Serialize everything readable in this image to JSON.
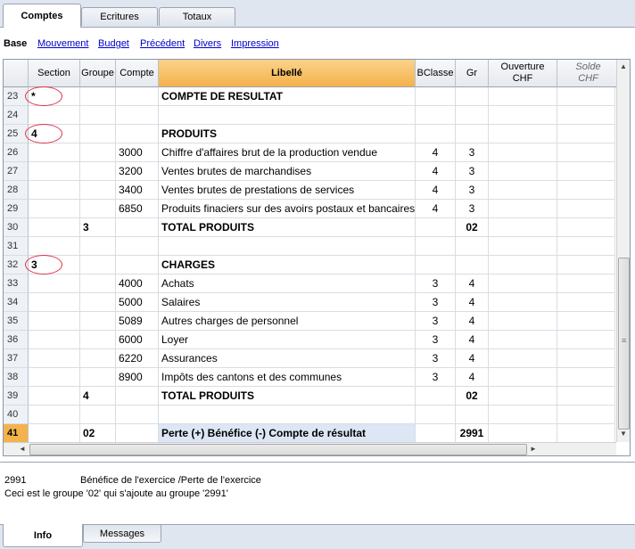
{
  "tabs": [
    {
      "label": "Comptes",
      "active": true
    },
    {
      "label": "Ecritures",
      "active": false
    },
    {
      "label": "Totaux",
      "active": false
    }
  ],
  "views": {
    "base": "Base",
    "links": [
      "Mouvement",
      "Budget",
      "Précédent",
      "Divers",
      "Impression"
    ]
  },
  "table": {
    "headers": {
      "section": "Section",
      "groupe": "Groupe",
      "compte": "Compte",
      "libelle": "Libellé",
      "bclasse": "BClasse",
      "gr": "Gr",
      "ouverture": "Ouverture CHF",
      "solde": "Solde CHF"
    },
    "rows": [
      {
        "n": "23",
        "section": "*",
        "groupe": "",
        "compte": "",
        "libelle": "COMPTE DE RESULTAT",
        "bclasse": "",
        "gr": "",
        "bold": true,
        "circled": true
      },
      {
        "n": "24",
        "section": "",
        "groupe": "",
        "compte": "",
        "libelle": "",
        "bclasse": "",
        "gr": ""
      },
      {
        "n": "25",
        "section": "4",
        "groupe": "",
        "compte": "",
        "libelle": "PRODUITS",
        "bclasse": "",
        "gr": "",
        "bold": true,
        "circled": true
      },
      {
        "n": "26",
        "section": "",
        "groupe": "",
        "compte": "3000",
        "libelle": "Chiffre d'affaires brut de la production vendue",
        "bclasse": "4",
        "gr": "3"
      },
      {
        "n": "27",
        "section": "",
        "groupe": "",
        "compte": "3200",
        "libelle": "Ventes brutes de marchandises",
        "bclasse": "4",
        "gr": "3"
      },
      {
        "n": "28",
        "section": "",
        "groupe": "",
        "compte": "3400",
        "libelle": "Ventes brutes de prestations de services",
        "bclasse": "4",
        "gr": "3"
      },
      {
        "n": "29",
        "section": "",
        "groupe": "",
        "compte": "6850",
        "libelle": "Produits finaciers sur des avoirs postaux et bancaires",
        "bclasse": "4",
        "gr": "3"
      },
      {
        "n": "30",
        "section": "",
        "groupe": "3",
        "compte": "",
        "libelle": "TOTAL PRODUITS",
        "bclasse": "",
        "gr": "02",
        "bold": true
      },
      {
        "n": "31",
        "section": "",
        "groupe": "",
        "compte": "",
        "libelle": "",
        "bclasse": "",
        "gr": ""
      },
      {
        "n": "32",
        "section": "3",
        "groupe": "",
        "compte": "",
        "libelle": "CHARGES",
        "bclasse": "",
        "gr": "",
        "bold": true,
        "circled": true
      },
      {
        "n": "33",
        "section": "",
        "groupe": "",
        "compte": "4000",
        "libelle": "Achats",
        "bclasse": "3",
        "gr": "4"
      },
      {
        "n": "34",
        "section": "",
        "groupe": "",
        "compte": "5000",
        "libelle": "Salaires",
        "bclasse": "3",
        "gr": "4"
      },
      {
        "n": "35",
        "section": "",
        "groupe": "",
        "compte": "5089",
        "libelle": "Autres charges de personnel",
        "bclasse": "3",
        "gr": "4"
      },
      {
        "n": "36",
        "section": "",
        "groupe": "",
        "compte": "6000",
        "libelle": "Loyer",
        "bclasse": "3",
        "gr": "4"
      },
      {
        "n": "37",
        "section": "",
        "groupe": "",
        "compte": "6220",
        "libelle": "Assurances",
        "bclasse": "3",
        "gr": "4"
      },
      {
        "n": "38",
        "section": "",
        "groupe": "",
        "compte": "8900",
        "libelle": "Impôts des cantons et des communes",
        "bclasse": "3",
        "gr": "4"
      },
      {
        "n": "39",
        "section": "",
        "groupe": "4",
        "compte": "",
        "libelle": "TOTAL PRODUITS",
        "bclasse": "",
        "gr": "02",
        "bold": true
      },
      {
        "n": "40",
        "section": "",
        "groupe": "",
        "compte": "",
        "libelle": "",
        "bclasse": "",
        "gr": ""
      },
      {
        "n": "41",
        "section": "",
        "groupe": "02",
        "compte": "",
        "libelle": "Perte (+) Bénéfice (-) Compte de résultat",
        "bclasse": "",
        "gr": "2991",
        "bold": true,
        "selected": true
      }
    ]
  },
  "info": {
    "code": "2991",
    "description": "Bénéfice de l'exercice /Perte de l'exercice",
    "note": "Ceci est le groupe '02' qui s'ajoute au groupe '2991'"
  },
  "bottom_tabs": [
    {
      "label": "Info",
      "active": true
    },
    {
      "label": "Messages",
      "active": false
    }
  ],
  "colors": {
    "header_accent": "#f4b24c",
    "link": "#0000cc",
    "annotation_circle": "#e03048"
  }
}
